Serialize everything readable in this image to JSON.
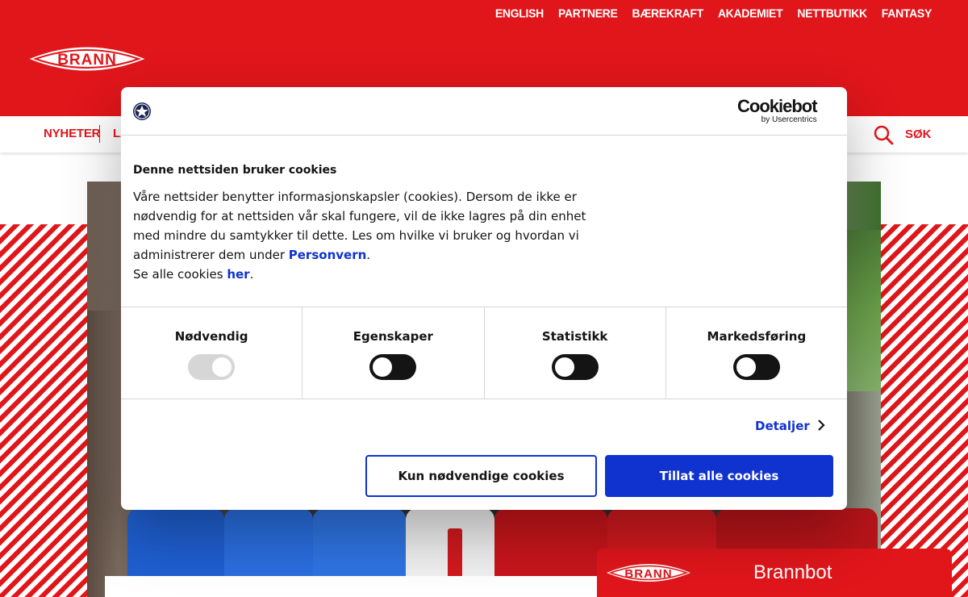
{
  "header": {
    "top_links": [
      "ENGLISH",
      "PARTNERE",
      "BÆREKRAFT",
      "AKADEMIET",
      "NETTBUTIKK",
      "FANTASY"
    ],
    "logo_text": "BRANN",
    "nav": {
      "first_item": "NYHETER",
      "second_item_partial": "LA",
      "search_label": "SØK"
    }
  },
  "cookie_dialog": {
    "brand": {
      "name": "Cookiebot",
      "sub": "by Usercentrics"
    },
    "title": "Denne nettsiden bruker cookies",
    "body_text": "Våre nettsider benytter informasjonskapsler (cookies). Dersom de ikke er nødvendig for at nettsiden vår skal fungere, vil de ikke lagres på din enhet med mindre du samtykker til dette. Les om hvilke vi bruker og hvordan vi administrerer dem under ",
    "privacy_link": "Personvern",
    "body_text_end": ".",
    "see_all_text": "Se alle cookies ",
    "see_all_link": "her",
    "see_all_end": ".",
    "categories": [
      {
        "label": "Nødvendig",
        "enabled": true,
        "disabled": true
      },
      {
        "label": "Egenskaper",
        "enabled": false,
        "disabled": false
      },
      {
        "label": "Statistikk",
        "enabled": false,
        "disabled": false
      },
      {
        "label": "Markedsføring",
        "enabled": false,
        "disabled": false
      }
    ],
    "details_label": "Detaljer",
    "btn_necessary": "Kun nødvendige cookies",
    "btn_allow_all": "Tillat alle cookies"
  },
  "chatbot": {
    "logo_text": "BRANN",
    "title": "Brannbot"
  },
  "colors": {
    "brand_red": "#e0161b",
    "accent_blue": "#1032cf",
    "text": "#141414"
  }
}
